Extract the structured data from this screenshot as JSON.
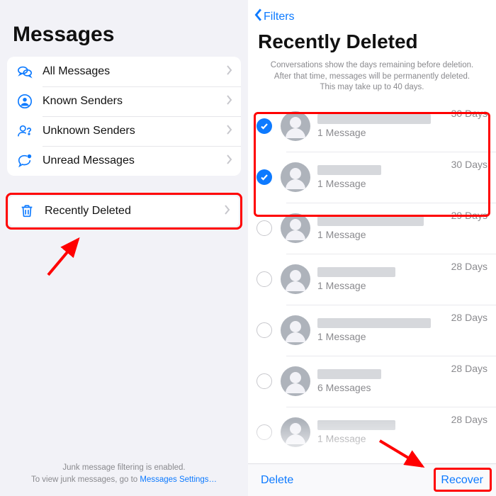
{
  "left": {
    "title": "Messages",
    "items": [
      {
        "label": "All Messages",
        "icon": "bubbles"
      },
      {
        "label": "Known Senders",
        "icon": "person-circle"
      },
      {
        "label": "Unknown Senders",
        "icon": "person-question"
      },
      {
        "label": "Unread Messages",
        "icon": "bubble-dot"
      }
    ],
    "deleted_label": "Recently Deleted",
    "footer_line1": "Junk message filtering is enabled.",
    "footer_line2_pre": "To view junk messages, go to ",
    "footer_link": "Messages Settings…"
  },
  "right": {
    "back_label": "Filters",
    "title": "Recently Deleted",
    "note_l1": "Conversations show the days remaining before deletion.",
    "note_l2": "After that time, messages will be permanently deleted.",
    "note_l3": "This may take up to 40 days.",
    "items": [
      {
        "selected": true,
        "name_w": 160,
        "count": "1 Message",
        "days": "30 Days"
      },
      {
        "selected": true,
        "name_w": 90,
        "count": "1 Message",
        "days": "30 Days"
      },
      {
        "selected": false,
        "name_w": 150,
        "count": "1 Message",
        "days": "29 Days"
      },
      {
        "selected": false,
        "name_w": 110,
        "count": "1 Message",
        "days": "28 Days"
      },
      {
        "selected": false,
        "name_w": 160,
        "count": "1 Message",
        "days": "28 Days"
      },
      {
        "selected": false,
        "name_w": 90,
        "count": "6 Messages",
        "days": "28 Days"
      },
      {
        "selected": false,
        "name_w": 110,
        "count": "1 Message",
        "days": "28 Days"
      }
    ],
    "delete_label": "Delete",
    "recover_label": "Recover"
  }
}
